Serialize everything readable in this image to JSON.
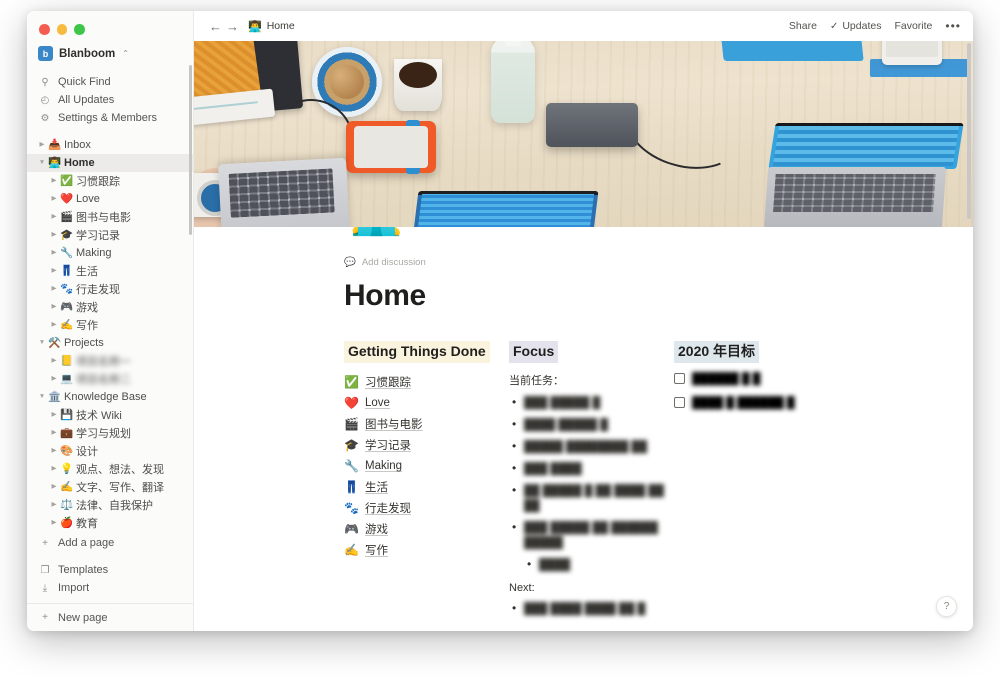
{
  "window": {
    "traffic_lights": [
      "close",
      "minimize",
      "zoom"
    ]
  },
  "sidebar": {
    "workspace": {
      "name": "Blanboom",
      "logo_letter": "b",
      "caret": "⌃"
    },
    "quick_nav": [
      {
        "icon": "search-icon",
        "glyph": "⚲",
        "label": "Quick Find"
      },
      {
        "icon": "clock-icon",
        "glyph": "◴",
        "label": "All Updates"
      },
      {
        "icon": "gear-icon",
        "glyph": "⚙",
        "label": "Settings & Members"
      }
    ],
    "tree": [
      {
        "level": 0,
        "triangle": "▶",
        "emoji": "📥",
        "label": "Inbox",
        "bold": false,
        "selected": false,
        "blurred": false
      },
      {
        "level": 0,
        "triangle": "▼",
        "emoji": "👨‍💻",
        "label": "Home",
        "bold": true,
        "selected": true,
        "blurred": false
      },
      {
        "level": 1,
        "triangle": "▶",
        "emoji": "✅",
        "label": "习惯跟踪",
        "bold": false,
        "selected": false,
        "blurred": false
      },
      {
        "level": 1,
        "triangle": "▶",
        "emoji": "❤️",
        "label": "Love",
        "bold": false,
        "selected": false,
        "blurred": false
      },
      {
        "level": 1,
        "triangle": "▶",
        "emoji": "🎬",
        "label": "图书与电影",
        "bold": false,
        "selected": false,
        "blurred": false
      },
      {
        "level": 1,
        "triangle": "▶",
        "emoji": "🎓",
        "label": "学习记录",
        "bold": false,
        "selected": false,
        "blurred": false
      },
      {
        "level": 1,
        "triangle": "▶",
        "emoji": "🔧",
        "label": "Making",
        "bold": false,
        "selected": false,
        "blurred": false
      },
      {
        "level": 1,
        "triangle": "▶",
        "emoji": "👖",
        "label": "生活",
        "bold": false,
        "selected": false,
        "blurred": false
      },
      {
        "level": 1,
        "triangle": "▶",
        "emoji": "🐾",
        "label": "行走发现",
        "bold": false,
        "selected": false,
        "blurred": false
      },
      {
        "level": 1,
        "triangle": "▶",
        "emoji": "🎮",
        "label": "游戏",
        "bold": false,
        "selected": false,
        "blurred": false
      },
      {
        "level": 1,
        "triangle": "▶",
        "emoji": "✍️",
        "label": "写作",
        "bold": false,
        "selected": false,
        "blurred": false
      },
      {
        "level": 0,
        "triangle": "▼",
        "emoji": "⚒️",
        "label": "Projects",
        "bold": false,
        "selected": false,
        "blurred": false
      },
      {
        "level": 1,
        "triangle": "▶",
        "emoji": "📒",
        "label": "项目名称一",
        "bold": false,
        "selected": false,
        "blurred": true
      },
      {
        "level": 1,
        "triangle": "▶",
        "emoji": "💻",
        "label": "项目名称二",
        "bold": false,
        "selected": false,
        "blurred": true
      },
      {
        "level": 0,
        "triangle": "▼",
        "emoji": "🏛️",
        "label": "Knowledge Base",
        "bold": false,
        "selected": false,
        "blurred": false
      },
      {
        "level": 1,
        "triangle": "▶",
        "emoji": "💾",
        "label": "技术 Wiki",
        "bold": false,
        "selected": false,
        "blurred": false
      },
      {
        "level": 1,
        "triangle": "▶",
        "emoji": "💼",
        "label": "学习与规划",
        "bold": false,
        "selected": false,
        "blurred": false
      },
      {
        "level": 1,
        "triangle": "▶",
        "emoji": "🎨",
        "label": "设计",
        "bold": false,
        "selected": false,
        "blurred": false
      },
      {
        "level": 1,
        "triangle": "▶",
        "emoji": "💡",
        "label": "观点、想法、发现",
        "bold": false,
        "selected": false,
        "blurred": false
      },
      {
        "level": 1,
        "triangle": "▶",
        "emoji": "✍️",
        "label": "文字、写作、翻译",
        "bold": false,
        "selected": false,
        "blurred": false
      },
      {
        "level": 1,
        "triangle": "▶",
        "emoji": "⚖️",
        "label": "法律、自我保护",
        "bold": false,
        "selected": false,
        "blurred": false
      },
      {
        "level": 1,
        "triangle": "▶",
        "emoji": "🍎",
        "label": "教育",
        "bold": false,
        "selected": false,
        "blurred": false
      }
    ],
    "add_page": {
      "glyph": "+",
      "label": "Add a page"
    },
    "utilities": [
      {
        "icon": "templates-icon",
        "glyph": "❐",
        "label": "Templates"
      },
      {
        "icon": "import-icon",
        "glyph": "⤓",
        "label": "Import"
      }
    ],
    "new_page": {
      "glyph": "+",
      "label": "New page"
    }
  },
  "topbar": {
    "back_glyph": "←",
    "forward_glyph": "→",
    "breadcrumb_emoji": "👨‍💻",
    "breadcrumb_label": "Home",
    "share_label": "Share",
    "updates_check": "✓",
    "updates_label": "Updates",
    "favorite_label": "Favorite",
    "more_glyph": "•••"
  },
  "page": {
    "cover_alt": "desk flat-lay photo with laptops, coffee and external drives",
    "page_emoji": "👨‍💻",
    "add_discussion_glyph": "💬",
    "add_discussion_label": "Add discussion",
    "title": "Home",
    "columns": [
      {
        "heading": "Getting Things Done",
        "highlight": "#faf3dd",
        "type": "page-links",
        "items": [
          {
            "emoji": "✅",
            "label": "习惯跟踪"
          },
          {
            "emoji": "❤️",
            "label": "Love"
          },
          {
            "emoji": "🎬",
            "label": "图书与电影"
          },
          {
            "emoji": "🎓",
            "label": "学习记录"
          },
          {
            "emoji": "🔧",
            "label": "Making"
          },
          {
            "emoji": "👖",
            "label": "生活"
          },
          {
            "emoji": "🐾",
            "label": "行走发现"
          },
          {
            "emoji": "🎮",
            "label": "游戏"
          },
          {
            "emoji": "✍️",
            "label": "写作"
          }
        ]
      },
      {
        "heading": "Focus",
        "highlight": "#e4e2ec",
        "type": "bullets",
        "current_label": "当前任务：",
        "current_items": [
          {
            "text": "███ █████ █",
            "blurred": true,
            "nested": false
          },
          {
            "text": "████ █████ █",
            "blurred": true,
            "nested": false
          },
          {
            "text": "█████ ████████ ██",
            "blurred": true,
            "nested": false
          },
          {
            "text": "███ ████",
            "blurred": true,
            "nested": false
          },
          {
            "text": "██ █████ █ ██ ████ ██ ██",
            "blurred": true,
            "nested": false
          },
          {
            "text": "███ █████ ██ ██████ █████",
            "blurred": true,
            "nested": false
          },
          {
            "text": "████",
            "blurred": true,
            "nested": true
          }
        ],
        "next_label": "Next:",
        "next_items": [
          {
            "text": "███ ████ ████ ██ █",
            "blurred": true,
            "nested": false
          }
        ]
      },
      {
        "heading": "2020 年目标",
        "highlight": "#dde7ec",
        "type": "todos",
        "todos": [
          {
            "checked": false,
            "text": "██████ █ █",
            "blurred": true
          },
          {
            "checked": false,
            "text": "████ █ ██████ █",
            "blurred": true
          }
        ]
      }
    ],
    "help_glyph": "?"
  }
}
